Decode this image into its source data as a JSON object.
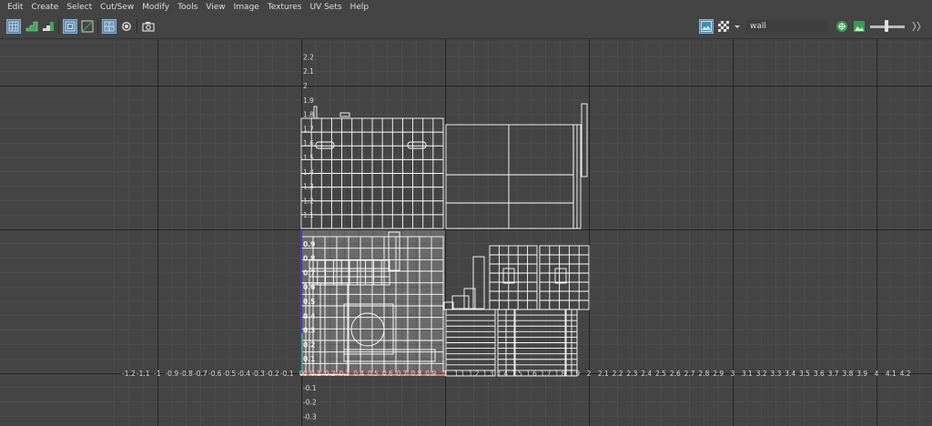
{
  "menu": [
    "Edit",
    "Create",
    "Select",
    "Cut/Sew",
    "Modify",
    "Tools",
    "View",
    "Image",
    "Textures",
    "UV Sets",
    "Help"
  ],
  "toolbar": {
    "left_icons": [
      "uv-grid-icon",
      "stair-green-icon",
      "stair-white-icon",
      "frame-all-icon",
      "frame-selection-icon",
      "shaded-uv-icon",
      "distortion-icon",
      "snapshot-icon"
    ],
    "right_icons": [
      "image-display-icon",
      "checker-icon",
      "dropdown-arrow-icon",
      "uv-toggle-icon",
      "image-toggle-icon"
    ],
    "texture_name": "wall"
  },
  "axes": {
    "x_labels": [
      "-1.2",
      "-1.1",
      "-1",
      "-0.9",
      "-0.8",
      "-0.7",
      "-0.6",
      "-0.5",
      "-0.4",
      "-0.3",
      "-0.2",
      "-0.1",
      "0",
      "0.1",
      "0.2",
      "0.3",
      "0.4",
      "0.5",
      "0.6",
      "0.7",
      "0.8",
      "0.9",
      "1",
      "1.1",
      "1.2",
      "1.3",
      "1.4",
      "1.5",
      "1.6",
      "1.7",
      "1.8",
      "1.9",
      "2",
      "2.1",
      "2.2",
      "2.3",
      "2.4",
      "2.5",
      "2.6",
      "2.7",
      "2.8",
      "2.9",
      "3",
      "3.1",
      "3.2",
      "3.3",
      "3.4",
      "3.5",
      "3.6",
      "3.7",
      "3.8",
      "3.9",
      "4",
      "4.1",
      "4.2"
    ],
    "y_labels_upper": [
      "2.2",
      "2.1",
      "2",
      "1.9",
      "1.8",
      "1.7",
      "1.6",
      "1.5",
      "1.4",
      "1.3",
      "1.2",
      "1.1"
    ],
    "y_labels_unit": [
      "0.9",
      "0.8",
      "0.7",
      "0.6",
      "0.5",
      "0.4",
      "0.3",
      "0.2",
      "0.1"
    ],
    "y_labels_neg": [
      "0",
      "-0.1",
      "-0.2",
      "-0.3"
    ],
    "x_range": [
      -1.2,
      4.2
    ],
    "y_range": [
      -0.35,
      2.3
    ]
  },
  "colors": {
    "background": "#444444",
    "grid_minor": "#4e4e4e",
    "grid_major": "#222222",
    "uv_wire": "#ffffff",
    "udim_fill": "#6a6a6a",
    "axis_u": "#d03030",
    "axis_v": "#4040e0",
    "active_button": "#5a7fa3"
  }
}
